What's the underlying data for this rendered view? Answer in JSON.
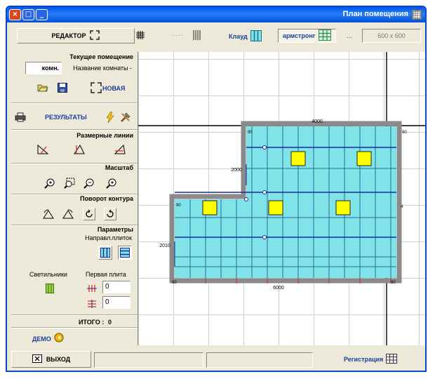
{
  "window": {
    "title": "План помещения",
    "controls": {
      "close": "×",
      "maximize": "□",
      "minimize": "_"
    }
  },
  "toolbar": {
    "editor_label": "РЕДАКТОР",
    "klaud_label": "Клауд",
    "armstrong_label": "армстронг",
    "ellipsis": "...",
    "size_value": "600 x 600"
  },
  "current_room": {
    "title": "Текущее помещение",
    "name_label": "Название комнаты -",
    "name_value": "комн.",
    "new_label": "НОВАЯ"
  },
  "results": {
    "label": "РЕЗУЛЬТАТЫ"
  },
  "dimension_lines": {
    "title": "Размерные линии"
  },
  "scale": {
    "title": "Масштаб"
  },
  "contour_rotation": {
    "title": "Поворот контура"
  },
  "parameters": {
    "title": "Параметры",
    "tile_direction_label": "Направл.плиток",
    "first_tile_label": "Первая плита",
    "lamps_label": "Светильники",
    "first_tile_values": [
      "0",
      "0"
    ]
  },
  "total": {
    "label": "ИТОГО :",
    "value": "0"
  },
  "demo": {
    "label": "ДЕМО"
  },
  "status": {
    "exit_label": "ВЫХОД",
    "register_label": "Регистрация"
  },
  "plan": {
    "dimensions": {
      "top": "4000",
      "bottom": "6000",
      "middle_left": "2000",
      "left": "2010"
    },
    "corner_labels": [
      "90",
      "90",
      "90",
      "90",
      "90",
      "4"
    ],
    "colors": {
      "tile": "#7fe3e8",
      "lamp": "#ffff00",
      "wall": "#808080",
      "line_blue": "#1a2a9a",
      "line_red": "#d03030"
    }
  },
  "colors": {
    "titlebar": "#0058ee",
    "panel": "#ece9d8",
    "link_blue": "#1c3e9c"
  }
}
